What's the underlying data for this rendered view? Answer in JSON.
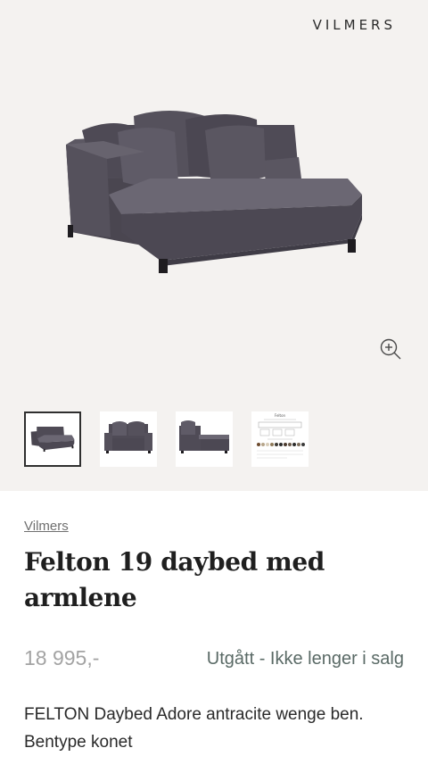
{
  "header": {
    "brand": "VILMERS"
  },
  "gallery": {
    "zoom_icon": "zoom-in-icon",
    "thumbnails": [
      {
        "name": "sofa-angle-view",
        "selected": true
      },
      {
        "name": "sofa-front-view",
        "selected": false
      },
      {
        "name": "sofa-side-view",
        "selected": false
      },
      {
        "name": "sofa-spec-sheet",
        "selected": false,
        "caption": "Felton"
      }
    ]
  },
  "product": {
    "breadcrumb": "Vilmers",
    "title": "Felton 19 daybed med armlene",
    "price": "18 995,-",
    "status": "Utgått - Ikke lenger i salg",
    "description": "FELTON Daybed Adore antracite wenge ben. Bentype konet"
  },
  "colors": {
    "gallery_bg": "#f4f2f0",
    "sofa": "#5a5661",
    "status": "#5a6a66"
  }
}
